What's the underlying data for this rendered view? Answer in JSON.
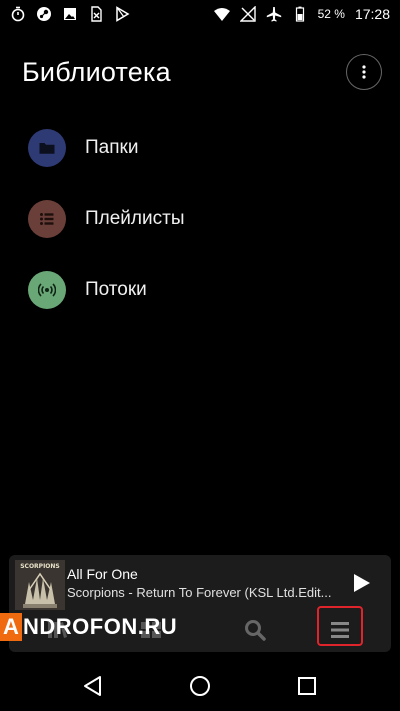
{
  "status_bar": {
    "left_icons": [
      "timer-icon",
      "steam-icon",
      "image-icon",
      "sim-icon",
      "play-store-icon"
    ],
    "right_icons": [
      "wifi-icon",
      "no-signal-icon",
      "airplane-icon",
      "battery-icon"
    ],
    "battery": "52 %",
    "time": "17:28"
  },
  "header": {
    "title": "Библиотека"
  },
  "library": {
    "items": [
      {
        "label": "Папки",
        "icon": "folder-icon",
        "color": "#2e3a74"
      },
      {
        "label": "Плейлисты",
        "icon": "list-icon",
        "color": "#6b3f39"
      },
      {
        "label": "Потоки",
        "icon": "stream-icon",
        "color": "#6aa776"
      }
    ]
  },
  "player": {
    "title": "All For One",
    "subtitle": "Scorpions - Return To Forever (KSL Ltd.Edit...",
    "album_art_text": "SCORPIONS"
  },
  "watermark": {
    "first": "A",
    "rest": "NDROFON.RU"
  },
  "colors": {
    "highlight": "#e0242b",
    "watermark_orange": "#f06a0f"
  }
}
